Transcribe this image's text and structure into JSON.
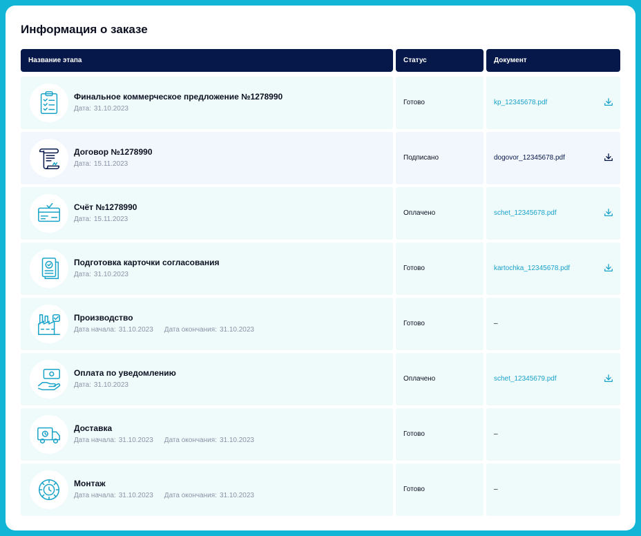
{
  "title": "Информация о заказе",
  "table": {
    "headers": [
      "Название этапа",
      "Статус",
      "Документ"
    ],
    "rows": [
      {
        "icon": "clipboard-checklist-icon",
        "name": "Финальное коммерческое предложение №1278990",
        "dates": [
          {
            "label": "Дата:",
            "value": "31.10.2023"
          }
        ],
        "status": "Готово",
        "document": "kp_12345678.pdf",
        "doc_color": "#1aa3c9",
        "style": "a"
      },
      {
        "icon": "contract-scroll-icon",
        "name": "Договор №1278990",
        "dates": [
          {
            "label": "Дата:",
            "value": "15.11.2023"
          }
        ],
        "status": "Подписано",
        "document": "dogovor_12345678.pdf",
        "doc_color": "#06174a",
        "style": "b"
      },
      {
        "icon": "invoice-card-icon",
        "name": "Счёт №1278990",
        "dates": [
          {
            "label": "Дата:",
            "value": "15.11.2023"
          }
        ],
        "status": "Оплачено",
        "document": "schet_12345678.pdf",
        "doc_color": "#1aa3c9",
        "style": "a"
      },
      {
        "icon": "approval-documents-icon",
        "name": "Подготовка карточки согласования",
        "dates": [
          {
            "label": "Дата:",
            "value": "31.10.2023"
          }
        ],
        "status": "Готово",
        "document": "kartochka_12345678.pdf",
        "doc_color": "#1aa3c9",
        "style": "a"
      },
      {
        "icon": "factory-icon",
        "name": "Производство",
        "dates": [
          {
            "label": "Дата начала:",
            "value": "31.10.2023"
          },
          {
            "label": "Дата окончания:",
            "value": "31.10.2023"
          }
        ],
        "status": "Готово",
        "document": "–",
        "doc_color": "",
        "style": "a"
      },
      {
        "icon": "hand-money-icon",
        "name": "Оплата по уведомлению",
        "dates": [
          {
            "label": "Дата:",
            "value": "31.10.2023"
          }
        ],
        "status": "Оплачено",
        "document": "schet_12345679.pdf",
        "doc_color": "#1aa3c9",
        "style": "a"
      },
      {
        "icon": "delivery-truck-icon",
        "name": "Доставка",
        "dates": [
          {
            "label": "Дата начала:",
            "value": "31.10.2023"
          },
          {
            "label": "Дата окончания:",
            "value": "31.10.2023"
          }
        ],
        "status": "Готово",
        "document": "–",
        "doc_color": "",
        "style": "a"
      },
      {
        "icon": "gear-installation-icon",
        "name": "Монтаж",
        "dates": [
          {
            "label": "Дата начала:",
            "value": "31.10.2023"
          },
          {
            "label": "Дата окончания:",
            "value": "31.10.2023"
          }
        ],
        "status": "Готово",
        "document": "–",
        "doc_color": "",
        "style": "a"
      }
    ]
  },
  "colors": {
    "frame": "#13b5d6",
    "header_bg": "#06174a",
    "accent": "#1aa3c9",
    "row_bg_light": "#effafb",
    "row_bg_blue": "#f2f6fd"
  }
}
